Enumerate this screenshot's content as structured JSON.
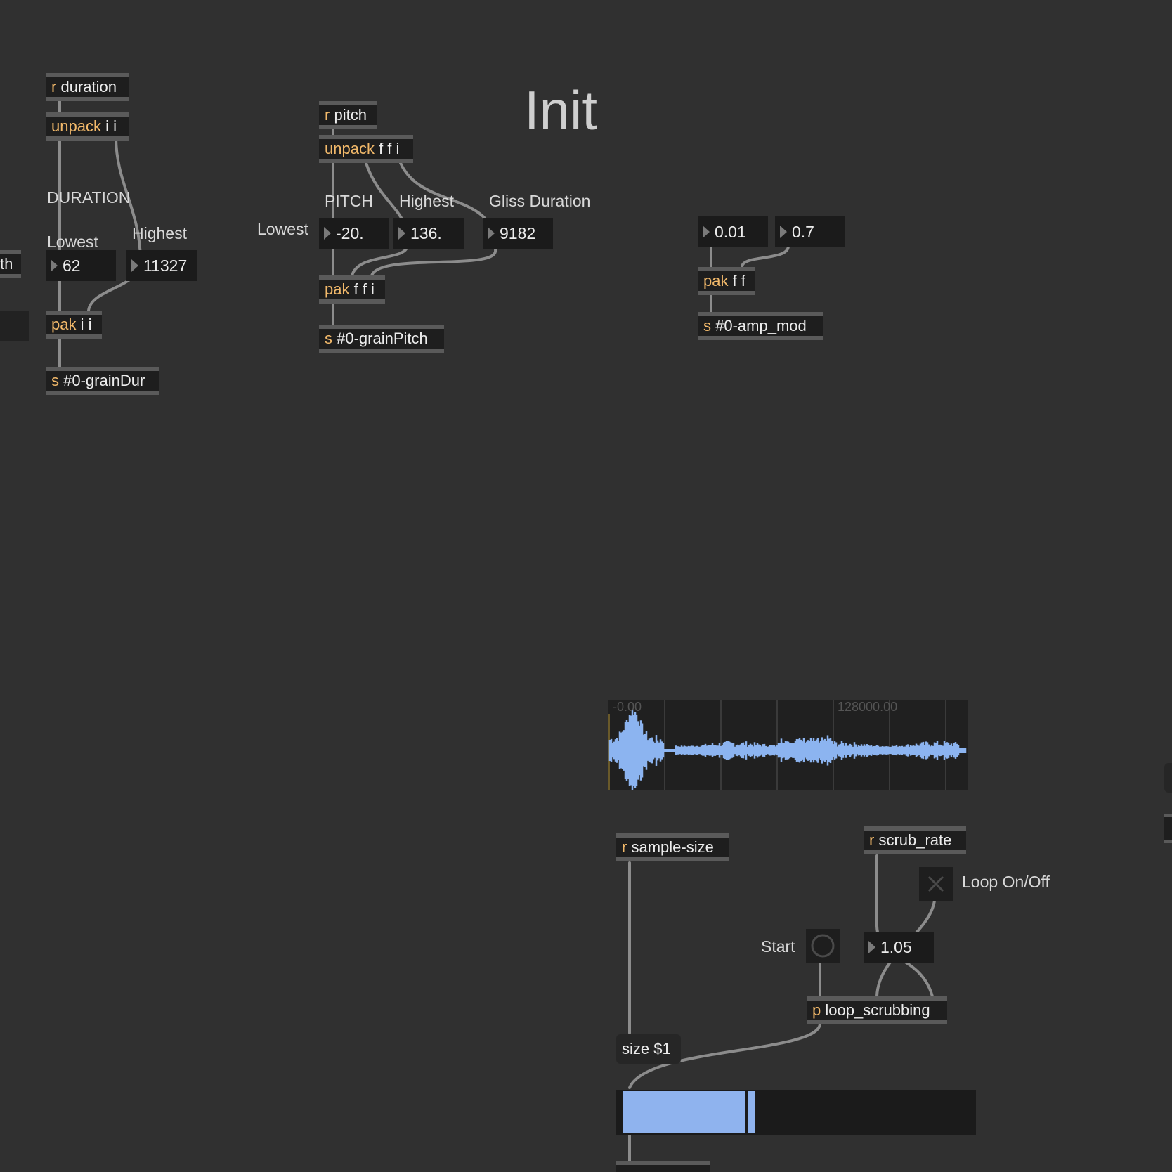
{
  "title": "Init",
  "duration": {
    "receive": {
      "kw": "r",
      "arg": "duration"
    },
    "unpack": {
      "kw": "unpack",
      "arg": "i i"
    },
    "section_label": "DURATION",
    "lowest_label": "Lowest",
    "highest_label": "Highest",
    "lowest_value": "62",
    "highest_value": "11327",
    "pak": {
      "kw": "pak",
      "arg": "i i"
    },
    "send": {
      "kw": "s",
      "arg": "#0-grainDur"
    }
  },
  "pitch": {
    "receive": {
      "kw": "r",
      "arg": "pitch"
    },
    "unpack": {
      "kw": "unpack",
      "arg": "f f i"
    },
    "section_label": "PITCH",
    "lowest_label": "Lowest",
    "highest_label": "Highest",
    "gliss_label": "Gliss Duration",
    "lowest_value": "-20.",
    "highest_value": "136.",
    "gliss_value": "9182",
    "pak": {
      "kw": "pak",
      "arg": "f f i"
    },
    "send": {
      "kw": "s",
      "arg": "#0-grainPitch"
    }
  },
  "amp": {
    "value1": "0.01",
    "value2": "0.7",
    "pak": {
      "kw": "pak",
      "arg": "f f"
    },
    "send": {
      "kw": "s",
      "arg": "#0-amp_mod"
    }
  },
  "left_edge": {
    "fragment": "th"
  },
  "waveform": {
    "left_time": "-0.00",
    "right_time": "128000.00",
    "wave_color": "#8cb4f0"
  },
  "scrub": {
    "sample_size": {
      "kw": "r",
      "arg": "sample-size"
    },
    "scrub_rate": {
      "kw": "r",
      "arg": "scrub_rate"
    },
    "loop_label": "Loop On/Off",
    "start_label": "Start",
    "rate_value": "1.05",
    "loop_scrubbing": {
      "kw": "p",
      "arg": "loop_scrubbing"
    },
    "size_msg": "size $1",
    "slider_fraction": 0.37,
    "slider_color": "#8fb3ee"
  }
}
